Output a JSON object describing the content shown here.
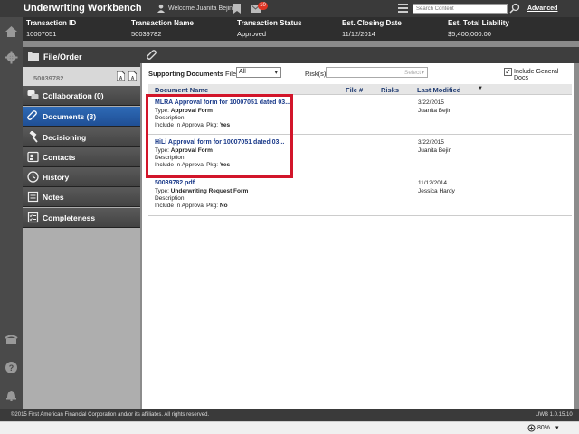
{
  "app": {
    "title": "Underwriting Workbench"
  },
  "header": {
    "welcome": "Welcome Juanita Bejin",
    "mail_count": "10",
    "search_placeholder": "Search Content",
    "advanced_label": "Advanced"
  },
  "transaction": {
    "columns": [
      {
        "label": "Transaction ID",
        "value": "10007051"
      },
      {
        "label": "Transaction Name",
        "value": "50039782"
      },
      {
        "label": "Transaction Status",
        "value": "Approved"
      },
      {
        "label": "Est. Closing Date",
        "value": "11/12/2014"
      },
      {
        "label": "Est. Total Liability",
        "value": "$5,400,000.00"
      }
    ]
  },
  "nav": {
    "header_label": "File/Order",
    "order_number": "50039782",
    "items": [
      {
        "label": "Collaboration (0)",
        "icon": "chat-bubbles-icon"
      },
      {
        "label": "Documents (3)",
        "icon": "paperclip-icon",
        "active": true
      },
      {
        "label": "Decisioning",
        "icon": "gavel-icon"
      },
      {
        "label": "Contacts",
        "icon": "contacts-card-icon"
      },
      {
        "label": "History",
        "icon": "clock-icon"
      },
      {
        "label": "Notes",
        "icon": "notes-icon"
      },
      {
        "label": "Completeness",
        "icon": "checklist-icon"
      }
    ]
  },
  "filters": {
    "supporting_label": "Supporting Documents",
    "file_label": "File",
    "file_value": "All",
    "risk_label": "Risk(s)",
    "risk_placeholder": "Select",
    "include_label": "Include General Docs",
    "include_checked": true
  },
  "table": {
    "headers": [
      "Document Name",
      "File #",
      "Risks",
      "Last Modified"
    ],
    "rows": [
      {
        "name": "MLRA Approval form for 10007051 dated 03...",
        "type_label": "Type:",
        "type": "Approval Form",
        "description_label": "Description:",
        "include_label": "Include In Approval Pkg:",
        "include": "Yes",
        "date": "3/22/2015",
        "user": "Juanita Bejin"
      },
      {
        "name": "HiLi Approval form for 10007051 dated 03...",
        "type_label": "Type:",
        "type": "Approval Form",
        "description_label": "Description:",
        "include_label": "Include In Approval Pkg:",
        "include": "Yes",
        "date": "3/22/2015",
        "user": "Juanita Bejin"
      },
      {
        "name": "50039782.pdf",
        "type_label": "Type:",
        "type": "Underwriting Request Form",
        "description_label": "Description:",
        "include_label": "Include In Approval Pkg:",
        "include": "No",
        "date": "11/12/2014",
        "user": "Jessica Hardy"
      }
    ]
  },
  "footer": {
    "copyright": "©2015 First American Financial Corporation and/or its affiliates. All rights reserved.",
    "version": "UWB 1.0.15.10"
  },
  "statusbar": {
    "zoom": "80%"
  },
  "colors": {
    "accent": "#1f4f95",
    "highlight": "#d2152a",
    "dark": "#3a3a3a"
  }
}
